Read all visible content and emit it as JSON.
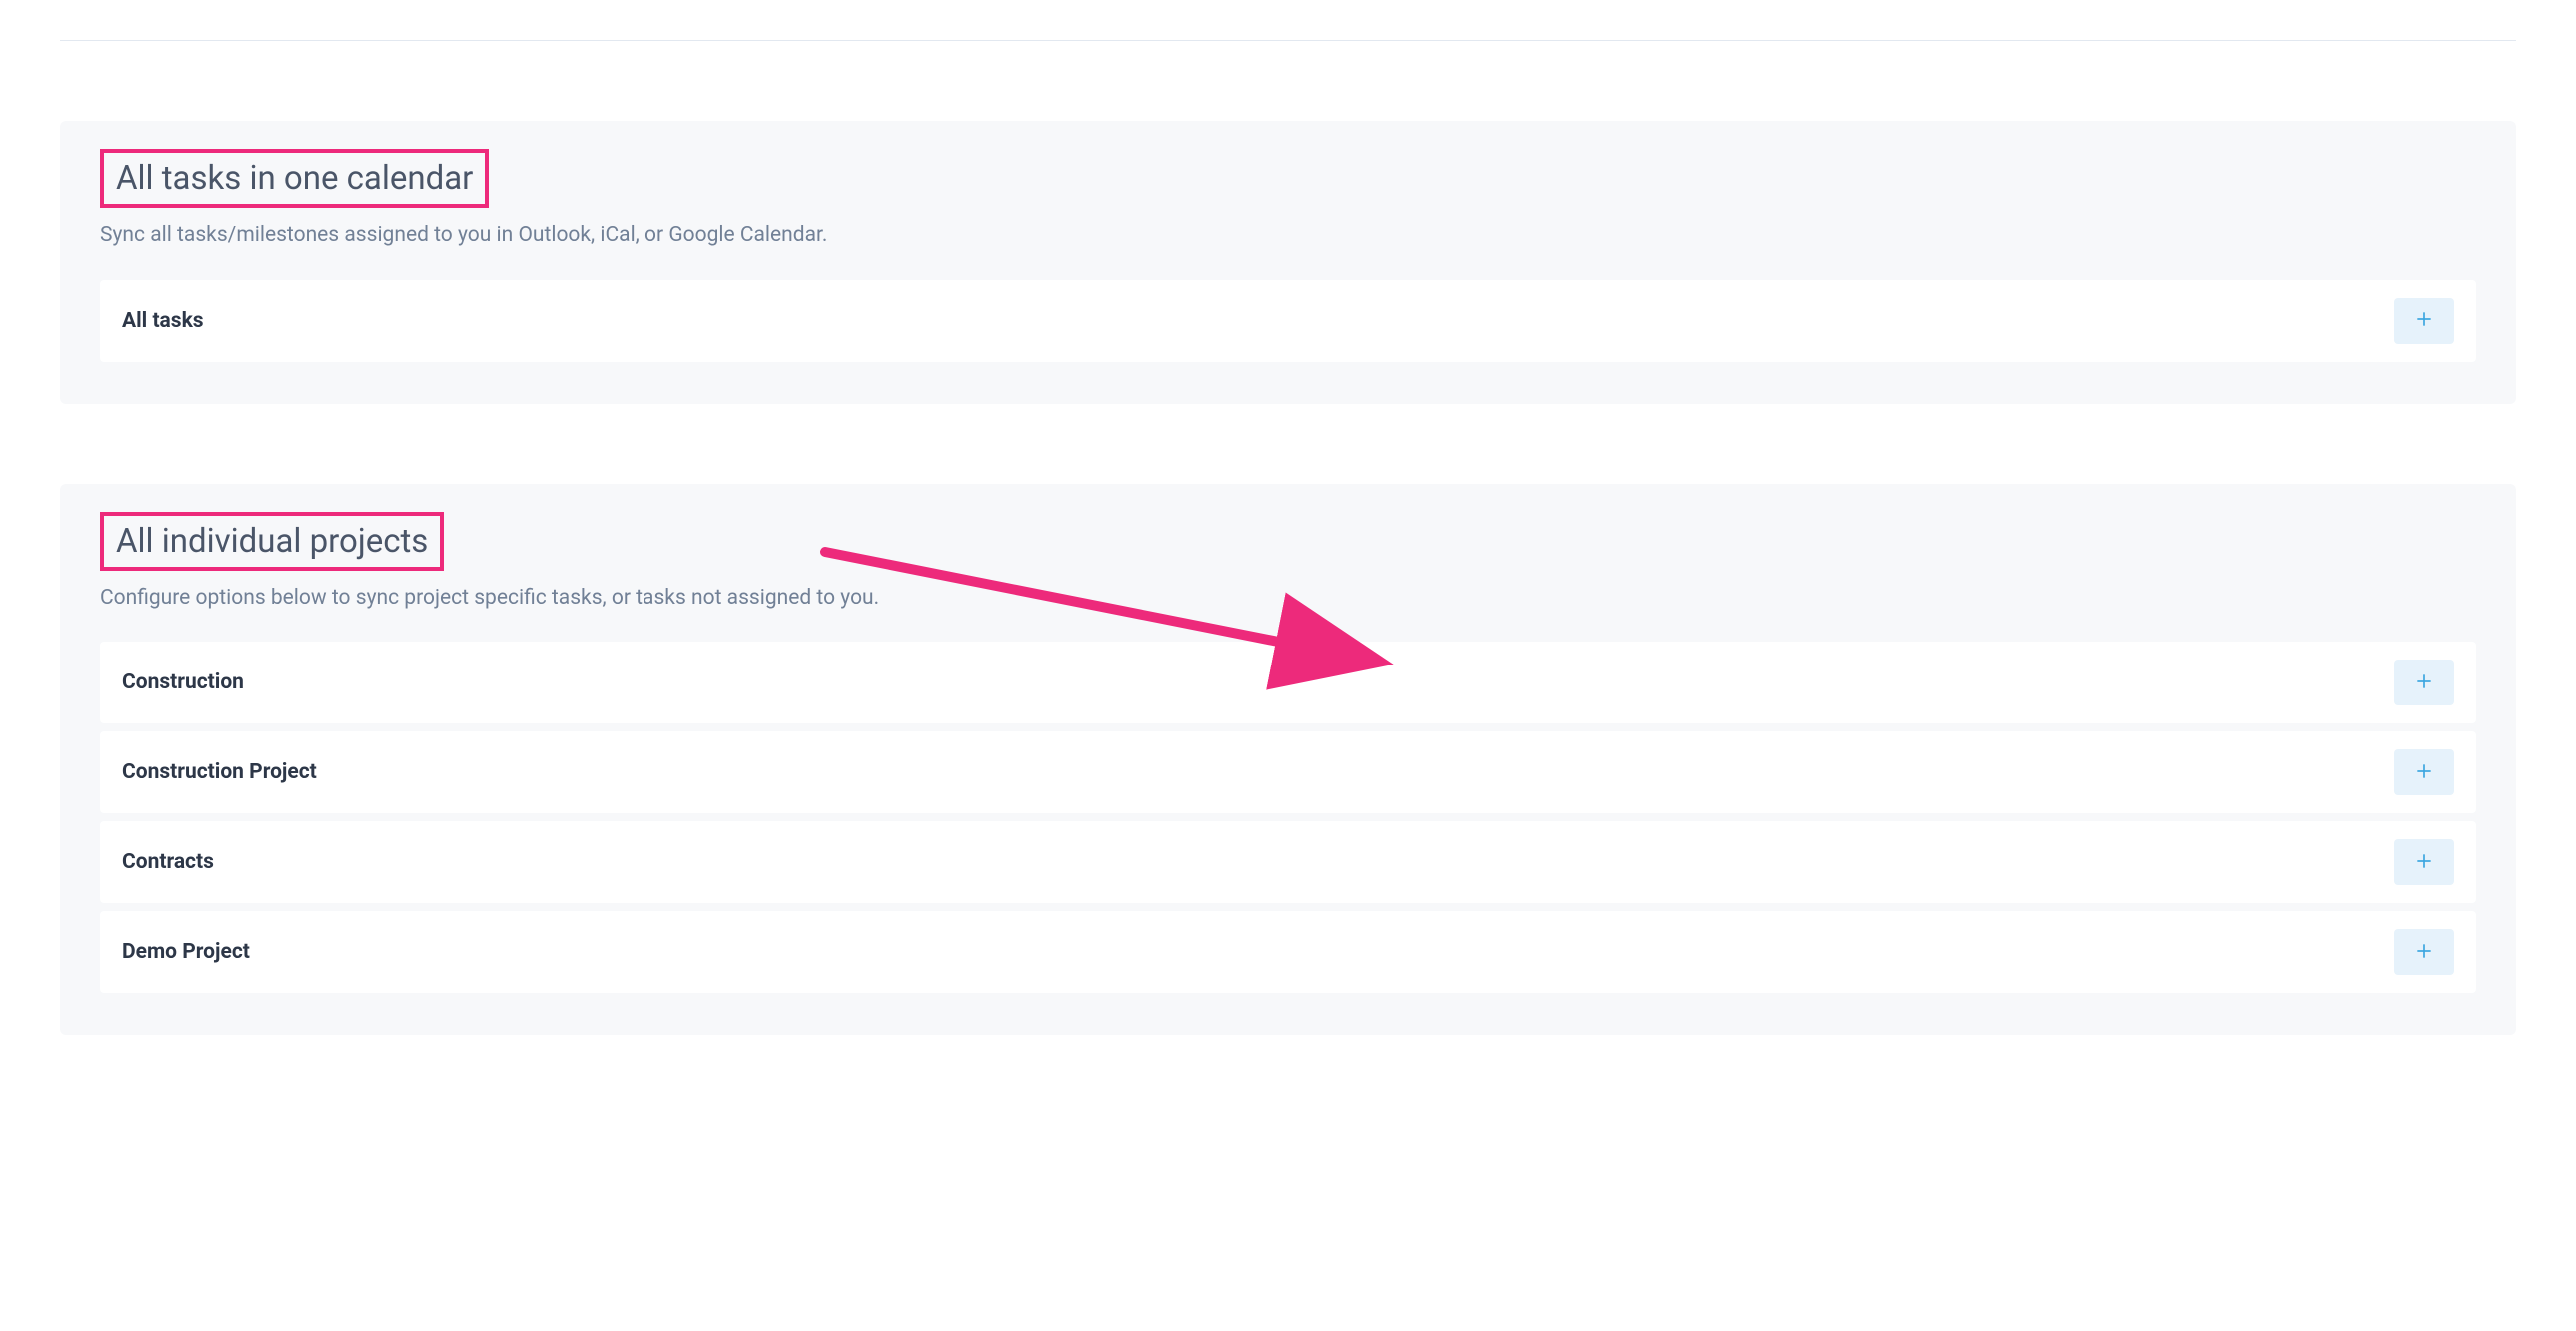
{
  "section1": {
    "title": "All tasks in one calendar",
    "subtitle": "Sync all tasks/milestones assigned to you in Outlook, iCal, or Google Calendar.",
    "items": [
      {
        "label": "All tasks"
      }
    ]
  },
  "section2": {
    "title": "All individual projects",
    "subtitle": "Configure options below to sync project specific tasks, or tasks not assigned to you.",
    "items": [
      {
        "label": "Construction"
      },
      {
        "label": "Construction Project"
      },
      {
        "label": "Contracts"
      },
      {
        "label": "Demo Project"
      }
    ]
  },
  "colors": {
    "highlight": "#ed2a7b",
    "plusIcon": "#3aa5e0",
    "plusBg": "#e6f2fb"
  }
}
